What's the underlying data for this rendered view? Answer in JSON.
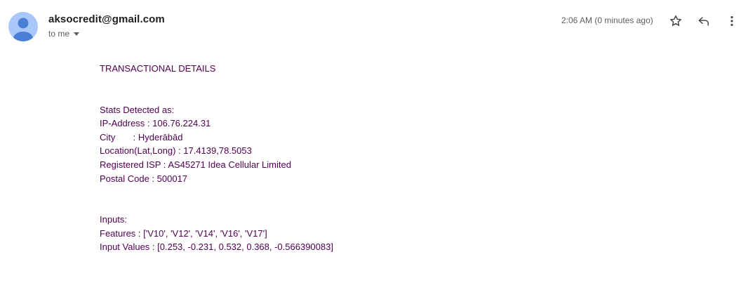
{
  "header": {
    "sender": "aksocredit@gmail.com",
    "recipient": "to me",
    "timestamp": "2:06 AM (0 minutes ago)",
    "icons": [
      "avatar",
      "chevron-down-icon",
      "star-icon",
      "reply-icon",
      "more-vert-icon"
    ]
  },
  "body": {
    "title": "TRANSACTIONAL DETAILS",
    "stats_heading": "Stats Detected as:",
    "ip_line": "IP-Address : 106.76.224.31",
    "city_line": "City       : Hyderābād",
    "location_line": "Location(Lat,Long) : 17.4139,78.5053",
    "isp_line": "Registered ISP : AS45271 Idea Cellular Limited",
    "postal_line": "Postal Code : 500017",
    "inputs_heading": "Inputs:",
    "features_line": "Features : ['V10', 'V12', 'V14', 'V16', 'V17']",
    "values_line": "Input Values : [0.253, -0.231, 0.532, 0.368, -0.566390083]"
  },
  "colors": {
    "body_text": "#500050",
    "avatar_bg": "#a8c7fa",
    "avatar_fg": "#4a7fd6"
  }
}
